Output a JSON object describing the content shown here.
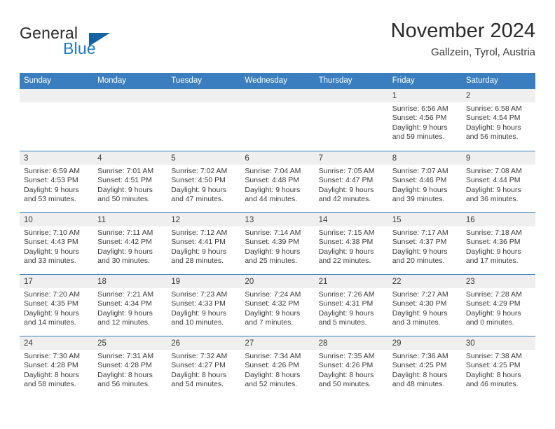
{
  "brand": {
    "word_general": "General",
    "word_blue": "Blue",
    "logo_icon": "triangle-logo-icon"
  },
  "header": {
    "month_title": "November 2024",
    "location": "Gallzein, Tyrol, Austria",
    "accent_color": "#3a7ebf",
    "brand_blue_color": "#1b7cc4"
  },
  "calendar": {
    "weekday_headers": [
      "Sunday",
      "Monday",
      "Tuesday",
      "Wednesday",
      "Thursday",
      "Friday",
      "Saturday"
    ],
    "weeks": [
      [
        {
          "day": "",
          "empty": true
        },
        {
          "day": "",
          "empty": true
        },
        {
          "day": "",
          "empty": true
        },
        {
          "day": "",
          "empty": true
        },
        {
          "day": "",
          "empty": true
        },
        {
          "day": "1",
          "sunrise": "Sunrise: 6:56 AM",
          "sunset": "Sunset: 4:56 PM",
          "daylight_1": "Daylight: 9 hours",
          "daylight_2": "and 59 minutes."
        },
        {
          "day": "2",
          "sunrise": "Sunrise: 6:58 AM",
          "sunset": "Sunset: 4:54 PM",
          "daylight_1": "Daylight: 9 hours",
          "daylight_2": "and 56 minutes."
        }
      ],
      [
        {
          "day": "3",
          "sunrise": "Sunrise: 6:59 AM",
          "sunset": "Sunset: 4:53 PM",
          "daylight_1": "Daylight: 9 hours",
          "daylight_2": "and 53 minutes."
        },
        {
          "day": "4",
          "sunrise": "Sunrise: 7:01 AM",
          "sunset": "Sunset: 4:51 PM",
          "daylight_1": "Daylight: 9 hours",
          "daylight_2": "and 50 minutes."
        },
        {
          "day": "5",
          "sunrise": "Sunrise: 7:02 AM",
          "sunset": "Sunset: 4:50 PM",
          "daylight_1": "Daylight: 9 hours",
          "daylight_2": "and 47 minutes."
        },
        {
          "day": "6",
          "sunrise": "Sunrise: 7:04 AM",
          "sunset": "Sunset: 4:48 PM",
          "daylight_1": "Daylight: 9 hours",
          "daylight_2": "and 44 minutes."
        },
        {
          "day": "7",
          "sunrise": "Sunrise: 7:05 AM",
          "sunset": "Sunset: 4:47 PM",
          "daylight_1": "Daylight: 9 hours",
          "daylight_2": "and 42 minutes."
        },
        {
          "day": "8",
          "sunrise": "Sunrise: 7:07 AM",
          "sunset": "Sunset: 4:46 PM",
          "daylight_1": "Daylight: 9 hours",
          "daylight_2": "and 39 minutes."
        },
        {
          "day": "9",
          "sunrise": "Sunrise: 7:08 AM",
          "sunset": "Sunset: 4:44 PM",
          "daylight_1": "Daylight: 9 hours",
          "daylight_2": "and 36 minutes."
        }
      ],
      [
        {
          "day": "10",
          "sunrise": "Sunrise: 7:10 AM",
          "sunset": "Sunset: 4:43 PM",
          "daylight_1": "Daylight: 9 hours",
          "daylight_2": "and 33 minutes."
        },
        {
          "day": "11",
          "sunrise": "Sunrise: 7:11 AM",
          "sunset": "Sunset: 4:42 PM",
          "daylight_1": "Daylight: 9 hours",
          "daylight_2": "and 30 minutes."
        },
        {
          "day": "12",
          "sunrise": "Sunrise: 7:12 AM",
          "sunset": "Sunset: 4:41 PM",
          "daylight_1": "Daylight: 9 hours",
          "daylight_2": "and 28 minutes."
        },
        {
          "day": "13",
          "sunrise": "Sunrise: 7:14 AM",
          "sunset": "Sunset: 4:39 PM",
          "daylight_1": "Daylight: 9 hours",
          "daylight_2": "and 25 minutes."
        },
        {
          "day": "14",
          "sunrise": "Sunrise: 7:15 AM",
          "sunset": "Sunset: 4:38 PM",
          "daylight_1": "Daylight: 9 hours",
          "daylight_2": "and 22 minutes."
        },
        {
          "day": "15",
          "sunrise": "Sunrise: 7:17 AM",
          "sunset": "Sunset: 4:37 PM",
          "daylight_1": "Daylight: 9 hours",
          "daylight_2": "and 20 minutes."
        },
        {
          "day": "16",
          "sunrise": "Sunrise: 7:18 AM",
          "sunset": "Sunset: 4:36 PM",
          "daylight_1": "Daylight: 9 hours",
          "daylight_2": "and 17 minutes."
        }
      ],
      [
        {
          "day": "17",
          "sunrise": "Sunrise: 7:20 AM",
          "sunset": "Sunset: 4:35 PM",
          "daylight_1": "Daylight: 9 hours",
          "daylight_2": "and 14 minutes."
        },
        {
          "day": "18",
          "sunrise": "Sunrise: 7:21 AM",
          "sunset": "Sunset: 4:34 PM",
          "daylight_1": "Daylight: 9 hours",
          "daylight_2": "and 12 minutes."
        },
        {
          "day": "19",
          "sunrise": "Sunrise: 7:23 AM",
          "sunset": "Sunset: 4:33 PM",
          "daylight_1": "Daylight: 9 hours",
          "daylight_2": "and 10 minutes."
        },
        {
          "day": "20",
          "sunrise": "Sunrise: 7:24 AM",
          "sunset": "Sunset: 4:32 PM",
          "daylight_1": "Daylight: 9 hours",
          "daylight_2": "and 7 minutes."
        },
        {
          "day": "21",
          "sunrise": "Sunrise: 7:26 AM",
          "sunset": "Sunset: 4:31 PM",
          "daylight_1": "Daylight: 9 hours",
          "daylight_2": "and 5 minutes."
        },
        {
          "day": "22",
          "sunrise": "Sunrise: 7:27 AM",
          "sunset": "Sunset: 4:30 PM",
          "daylight_1": "Daylight: 9 hours",
          "daylight_2": "and 3 minutes."
        },
        {
          "day": "23",
          "sunrise": "Sunrise: 7:28 AM",
          "sunset": "Sunset: 4:29 PM",
          "daylight_1": "Daylight: 9 hours",
          "daylight_2": "and 0 minutes."
        }
      ],
      [
        {
          "day": "24",
          "sunrise": "Sunrise: 7:30 AM",
          "sunset": "Sunset: 4:28 PM",
          "daylight_1": "Daylight: 8 hours",
          "daylight_2": "and 58 minutes."
        },
        {
          "day": "25",
          "sunrise": "Sunrise: 7:31 AM",
          "sunset": "Sunset: 4:28 PM",
          "daylight_1": "Daylight: 8 hours",
          "daylight_2": "and 56 minutes."
        },
        {
          "day": "26",
          "sunrise": "Sunrise: 7:32 AM",
          "sunset": "Sunset: 4:27 PM",
          "daylight_1": "Daylight: 8 hours",
          "daylight_2": "and 54 minutes."
        },
        {
          "day": "27",
          "sunrise": "Sunrise: 7:34 AM",
          "sunset": "Sunset: 4:26 PM",
          "daylight_1": "Daylight: 8 hours",
          "daylight_2": "and 52 minutes."
        },
        {
          "day": "28",
          "sunrise": "Sunrise: 7:35 AM",
          "sunset": "Sunset: 4:26 PM",
          "daylight_1": "Daylight: 8 hours",
          "daylight_2": "and 50 minutes."
        },
        {
          "day": "29",
          "sunrise": "Sunrise: 7:36 AM",
          "sunset": "Sunset: 4:25 PM",
          "daylight_1": "Daylight: 8 hours",
          "daylight_2": "and 48 minutes."
        },
        {
          "day": "30",
          "sunrise": "Sunrise: 7:38 AM",
          "sunset": "Sunset: 4:25 PM",
          "daylight_1": "Daylight: 8 hours",
          "daylight_2": "and 46 minutes."
        }
      ]
    ]
  }
}
